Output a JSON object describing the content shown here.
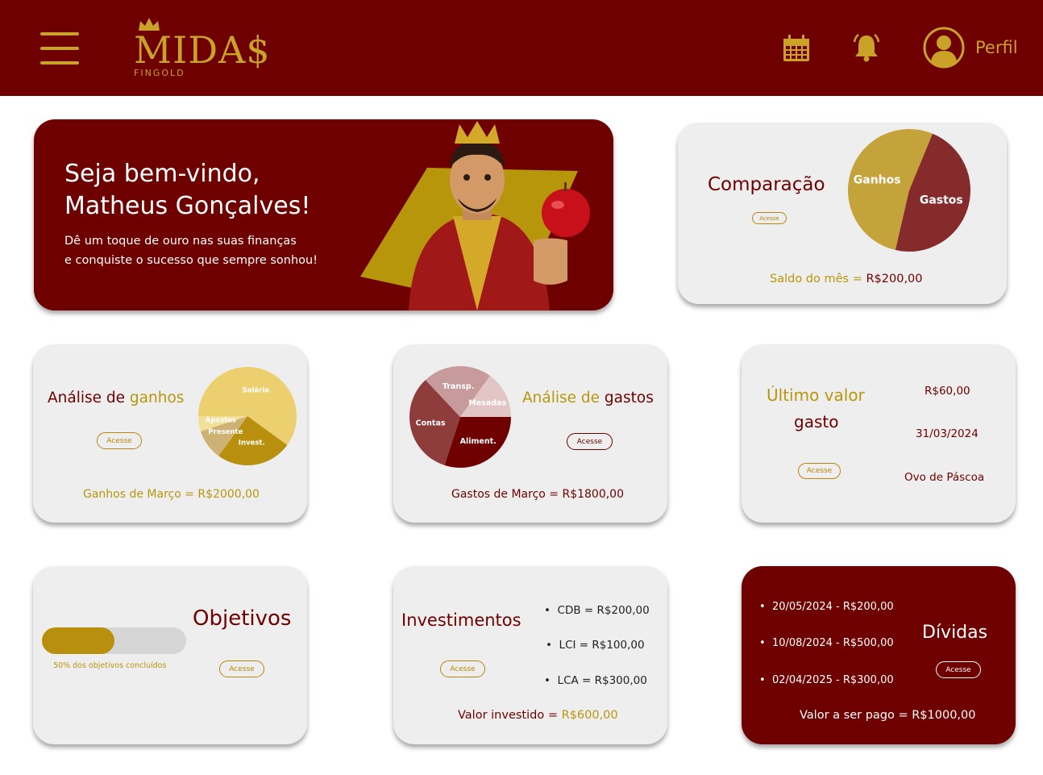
{
  "header": {
    "logo_main": "MIDA$",
    "logo_sub": "FINGOLD",
    "profile_label": "Perfil"
  },
  "welcome": {
    "title_line1": "Seja bem-vindo,",
    "title_line2": "Matheus Gonçalves!",
    "sub_line1": "Dê um toque de ouro nas suas finanças",
    "sub_line2": "e conquiste o sucesso que sempre sonhou!"
  },
  "comparacao": {
    "title": "Comparação",
    "button": "Acesse",
    "saldo_label": "Saldo do mês =",
    "saldo_value": "R$200,00",
    "chart_data": {
      "type": "pie",
      "categories": [
        "Ganhos",
        "Gastos"
      ],
      "values": [
        2000,
        1800
      ],
      "colors": [
        "#c4a33a",
        "#862b2b"
      ]
    }
  },
  "ganhos": {
    "title_a": "Análise de",
    "title_b": "ganhos",
    "button": "Acesse",
    "total": "Ganhos de Março = R$2000,00",
    "chart_data": {
      "type": "pie",
      "categories": [
        "Salário",
        "Invest.",
        "Presente",
        "Apostas"
      ],
      "values": [
        60,
        25,
        10,
        5
      ],
      "colors": [
        "#ecd06f",
        "#b8900d",
        "#cdb273",
        "#f2df98"
      ]
    }
  },
  "gastos": {
    "title_a": "Análise de",
    "title_b": "gastos",
    "button": "Acesse",
    "total": "Gastos de Março = R$1800,00",
    "chart_data": {
      "type": "pie",
      "categories": [
        "Aliment.",
        "Contas",
        "Transp.",
        "Mesadas"
      ],
      "values": [
        30,
        33,
        22,
        15
      ],
      "colors": [
        "#6e0000",
        "#8e3c3c",
        "#c79b9b",
        "#e2c6c6"
      ]
    }
  },
  "ultimo": {
    "title_line1": "Último valor",
    "title_line2": "gasto",
    "button": "Acesse",
    "value": "R$60,00",
    "date": "31/03/2024",
    "description": "Ovo de Páscoa"
  },
  "objetivos": {
    "title": "Objetivos",
    "button": "Acesse",
    "progress": 0.5,
    "progress_text": "50% dos objetivos concluídos"
  },
  "investimentos": {
    "title": "Investimentos",
    "button": "Acesse",
    "items": [
      "CDB = R$200,00",
      "LCI = R$100,00",
      "LCA = R$300,00"
    ],
    "total_label": "Valor investido =",
    "total_value": "R$600,00"
  },
  "dividas": {
    "title": "Dívidas",
    "button": "Acesse",
    "items": [
      "20/05/2024 - R$200,00",
      "10/08/2024 - R$500,00",
      "02/04/2025 - R$300,00"
    ],
    "total": "Valor a ser pago = R$1000,00"
  }
}
